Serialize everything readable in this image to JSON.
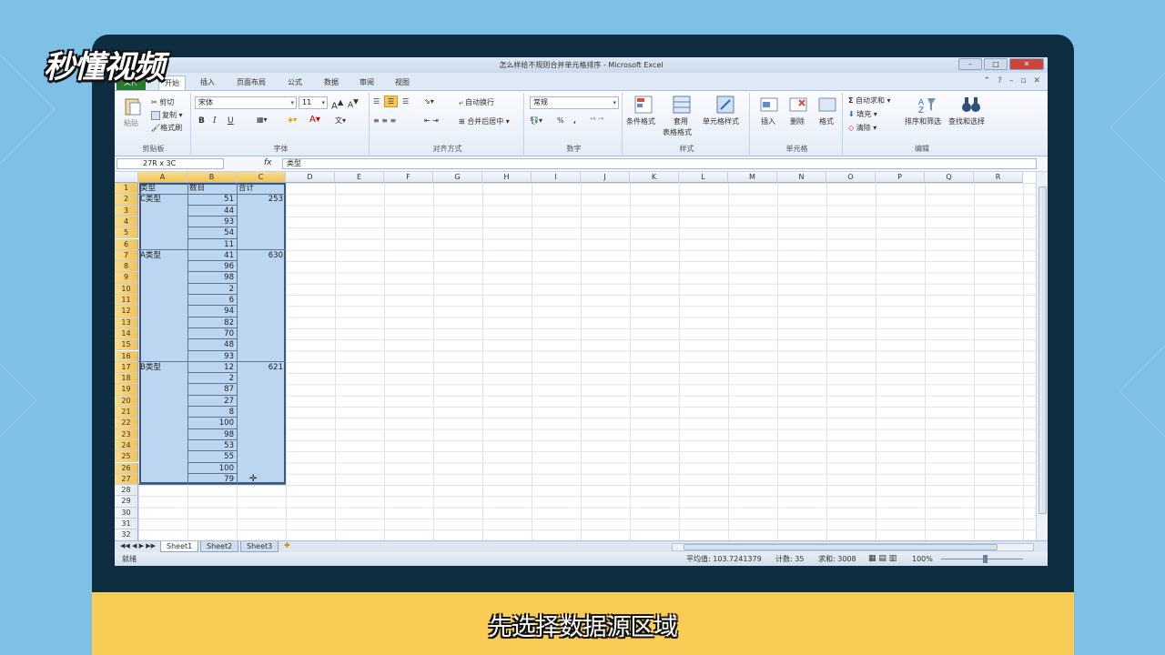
{
  "logo": "秒懂视频",
  "caption": "先选择数据源区域",
  "window": {
    "title": "怎么样给不规则合并单元格排序 - Microsoft Excel",
    "minimize": "–",
    "restore": "□",
    "close": "✕"
  },
  "tabs": [
    "文件",
    "开始",
    "插入",
    "页面布局",
    "公式",
    "数据",
    "审阅",
    "视图"
  ],
  "ribbon": {
    "clipboard": {
      "paste": "粘贴",
      "cut": "剪切",
      "copy": "复制",
      "format_painter": "格式刷",
      "label": "剪贴板"
    },
    "font": {
      "name": "宋体",
      "size": "11",
      "bold": "B",
      "italic": "I",
      "underline": "U",
      "label": "字体"
    },
    "alignment": {
      "wrap": "自动换行",
      "merge": "合并后居中",
      "label": "对齐方式"
    },
    "number": {
      "format": "常规",
      "percent": "%",
      "comma": ",",
      "label": "数字"
    },
    "styles": {
      "conditional": "条件格式",
      "table_format": "套用\n表格格式",
      "table_format_1": "套用",
      "table_format_2": "表格格式",
      "cell_styles": "单元格样式",
      "label": "样式"
    },
    "cells": {
      "insert": "插入",
      "delete": "删除",
      "format": "格式",
      "label": "单元格"
    },
    "editing": {
      "autosum": "自动求和",
      "fill": "填充",
      "clear": "清除",
      "sort_filter": "排序和筛选",
      "find_select": "查找和选择",
      "label": "编辑"
    }
  },
  "formula_bar": {
    "namebox": "27R x 3C",
    "fx": "fx",
    "content": "类型"
  },
  "columns": [
    "A",
    "B",
    "C",
    "D",
    "E",
    "F",
    "G",
    "H",
    "I",
    "J",
    "K",
    "L",
    "M",
    "N",
    "O",
    "P",
    "Q",
    "R"
  ],
  "rows": [
    "1",
    "2",
    "3",
    "4",
    "5",
    "6",
    "7",
    "8",
    "9",
    "10",
    "11",
    "12",
    "13",
    "14",
    "15",
    "16",
    "17",
    "18",
    "19",
    "20",
    "21",
    "22",
    "23",
    "24",
    "25",
    "26",
    "27",
    "28",
    "29",
    "30",
    "31",
    "32"
  ],
  "table": {
    "headers": [
      "类型",
      "数目",
      "合计"
    ],
    "groups": [
      {
        "type": "C类型",
        "total": "253",
        "values": [
          "51",
          "44",
          "93",
          "54",
          "11"
        ]
      },
      {
        "type": "A类型",
        "total": "630",
        "values": [
          "41",
          "96",
          "98",
          "2",
          "6",
          "94",
          "82",
          "70",
          "48",
          "93"
        ]
      },
      {
        "type": "B类型",
        "total": "621",
        "values": [
          "12",
          "2",
          "87",
          "27",
          "8",
          "100",
          "98",
          "53",
          "55",
          "100",
          "79"
        ]
      }
    ]
  },
  "sheets": [
    "Sheet1",
    "Sheet2",
    "Sheet3"
  ],
  "status": {
    "ready": "就绪",
    "average": "平均值: 103.7241379",
    "count": "计数: 35",
    "sum": "求和: 3008",
    "zoom": "100%"
  }
}
